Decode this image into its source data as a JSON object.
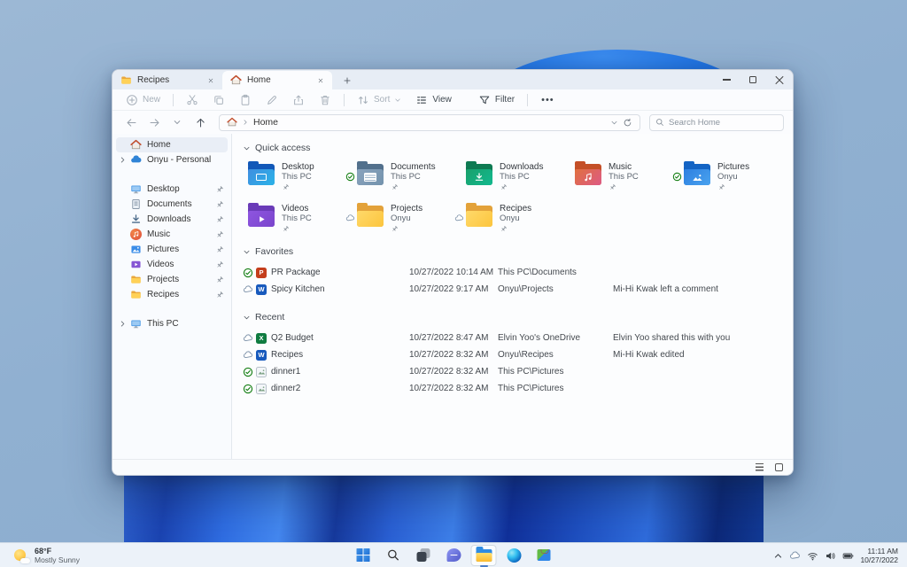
{
  "window_tabs": {
    "tabs": [
      {
        "label": "Recipes"
      },
      {
        "label": "Home"
      }
    ]
  },
  "toolbar": {
    "new": "New",
    "sort": "Sort",
    "view": "View",
    "filter": "Filter",
    "more": "•••"
  },
  "address": {
    "breadcrumb_root": "Home",
    "search_placeholder": "Search Home"
  },
  "sidebar": {
    "items": [
      {
        "label": "Home"
      },
      {
        "label": "Onyu - Personal"
      },
      {
        "label": "Desktop"
      },
      {
        "label": "Documents"
      },
      {
        "label": "Downloads"
      },
      {
        "label": "Music"
      },
      {
        "label": "Pictures"
      },
      {
        "label": "Videos"
      },
      {
        "label": "Projects"
      },
      {
        "label": "Recipes"
      },
      {
        "label": "This PC"
      }
    ]
  },
  "content": {
    "quick_access": {
      "label": "Quick access",
      "tiles": [
        {
          "name": "Desktop",
          "location": "This PC"
        },
        {
          "name": "Documents",
          "location": "This PC"
        },
        {
          "name": "Downloads",
          "location": "This PC"
        },
        {
          "name": "Music",
          "location": "This PC"
        },
        {
          "name": "Pictures",
          "location": "Onyu"
        },
        {
          "name": "Videos",
          "location": "This PC"
        },
        {
          "name": "Projects",
          "location": "Onyu"
        },
        {
          "name": "Recipes",
          "location": "Onyu"
        }
      ]
    },
    "favorites": {
      "label": "Favorites",
      "rows": [
        {
          "name": "PR Package",
          "date": "10/27/2022 10:14 AM",
          "location": "This PC\\Documents",
          "activity": ""
        },
        {
          "name": "Spicy Kitchen",
          "date": "10/27/2022 9:17 AM",
          "location": "Onyu\\Projects",
          "activity": "Mi-Hi Kwak left a comment"
        }
      ]
    },
    "recent": {
      "label": "Recent",
      "rows": [
        {
          "name": "Q2 Budget",
          "date": "10/27/2022 8:47 AM",
          "location": "Elvin Yoo's OneDrive",
          "activity": "Elvin Yoo shared this with you"
        },
        {
          "name": "Recipes",
          "date": "10/27/2022 8:32 AM",
          "location": "Onyu\\Recipes",
          "activity": "Mi-Hi Kwak edited"
        },
        {
          "name": "dinner1",
          "date": "10/27/2022 8:32 AM",
          "location": "This PC\\Pictures",
          "activity": ""
        },
        {
          "name": "dinner2",
          "date": "10/27/2022 8:32 AM",
          "location": "This PC\\Pictures",
          "activity": ""
        }
      ]
    }
  },
  "file_type_letters": {
    "powerpoint": "P",
    "word": "W",
    "excel": "X"
  },
  "taskbar": {
    "weather": {
      "temperature": "68°F",
      "condition": "Mostly Sunny"
    },
    "clock": {
      "time": "11:11 AM",
      "date": "10/27/2022"
    }
  },
  "colors": {
    "accent_blue": "#0067c0",
    "folder_yellow": "#ffd157",
    "sync_green": "#107c10",
    "word_blue": "#185abd",
    "excel_green": "#107c41",
    "powerpoint_orange": "#c43e1c",
    "wallpaper_blue": "#2a62d4"
  }
}
